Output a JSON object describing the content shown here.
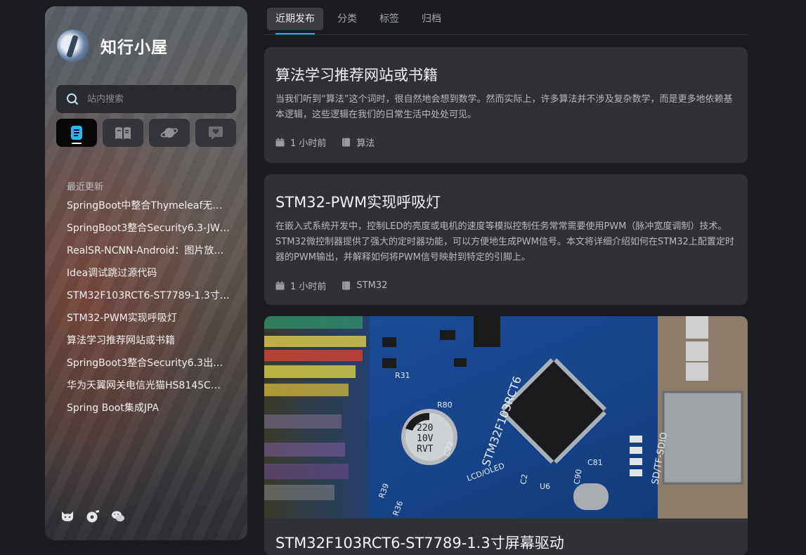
{
  "sidebar": {
    "site_name": "知行小屋",
    "search_placeholder": "站内搜索",
    "iconbar": [
      {
        "icon": "document-icon",
        "active": true
      },
      {
        "icon": "book-icon",
        "active": false
      },
      {
        "icon": "planet-icon",
        "active": false
      },
      {
        "icon": "heart-message-icon",
        "active": false
      }
    ],
    "recent_title": "最近更新",
    "recent_items": [
      "SpringBoot中整合Thymeleaf无…",
      "SpringBoot3整合Security6.3-JW…",
      "RealSR-NCNN-Android：图片放…",
      "Idea调试跳过源代码",
      "STM32F103RCT6-ST7789-1.3寸…",
      "STM32-PWM实现呼吸灯",
      "算法学习推荐网站或书籍",
      "SpringBoot3整合Security6.3出…",
      "华为天翼网关电信光猫HS8145C…",
      "Spring Boot集成JPA"
    ],
    "social": [
      "github-icon",
      "music-disc-icon",
      "wechat-icon"
    ]
  },
  "tabs": [
    "近期发布",
    "分类",
    "标签",
    "归档"
  ],
  "active_tab": "近期发布",
  "posts": [
    {
      "title": "算法学习推荐网站或书籍",
      "excerpt": "当我们听到“算法”这个词时，很自然地会想到数学。然而实际上，许多算法并不涉及复杂数学，而是更多地依赖基本逻辑，这些逻辑在我们的日常生活中处处可见。",
      "time": "1 小时前",
      "category": "算法"
    },
    {
      "title": "STM32-PWM实现呼吸灯",
      "excerpt": "在嵌入式系统开发中，控制LED的亮度或电机的速度等模拟控制任务常常需要使用PWM（脉冲宽度调制）技术。STM32微控制器提供了强大的定时器功能，可以方便地生成PWM信号。本文将详细介绍如何在STM32上配置定时器的PWM输出，并解释如何将PWM信号映射到特定的引脚上。",
      "time": "1 小时前",
      "category": "STM32"
    },
    {
      "title": "STM32F103RCT6-ST7789-1.3寸屏幕驱动",
      "image_text": {
        "chip": "STM32F103RCT6",
        "cap_line1": "220",
        "cap_line2": "10V",
        "cap_line3": "RVT",
        "label_sd": "SD/TF-SDIO",
        "label_lcd": "LCD/OLED",
        "label_c22": "C22",
        "label_r80": "R80",
        "label_r31": "R31",
        "label_c90": "C90",
        "label_c81": "C81",
        "label_r36": "R36",
        "label_r39": "R39",
        "label_u6": "U6",
        "label_c2": "C2"
      }
    }
  ],
  "colors": {
    "accent": "#27a9e1",
    "card_bg": "#2f3136",
    "page_bg": "#1b1c20"
  }
}
